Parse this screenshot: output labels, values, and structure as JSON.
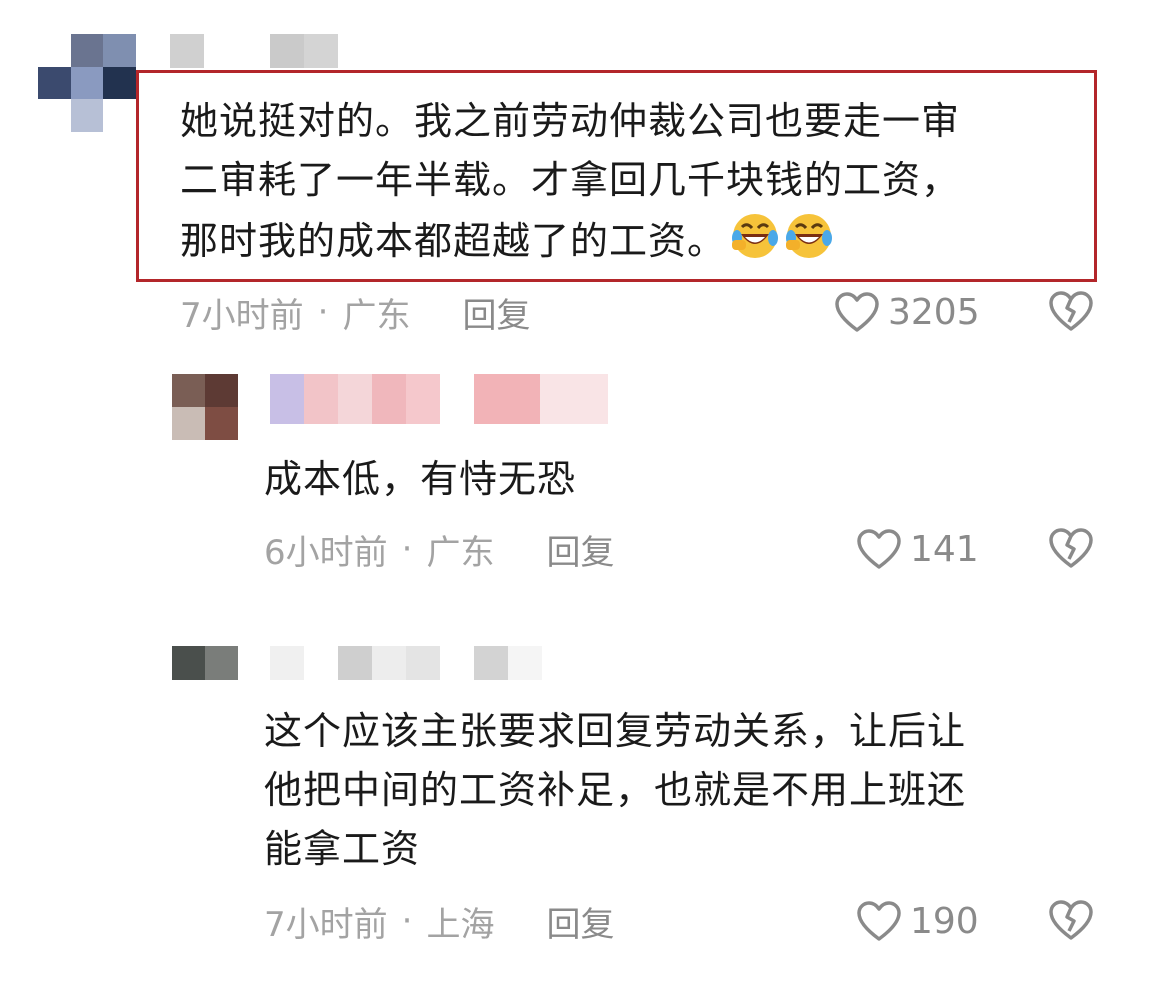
{
  "comments": [
    {
      "text": "她说挺对的。我之前劳动仲裁公司也要走一审\n二审耗了一年半载。才拿回几千块钱的工资，\n那时我的成本都超越了的工资。",
      "emoji": [
        "rofl-emoji",
        "rofl-emoji"
      ],
      "time": "7小时前",
      "dot": "·",
      "location": "广东",
      "reply_label": "回复",
      "likes": "3205",
      "highlighted": true
    },
    {
      "text": "成本低，有恃无恐",
      "time": "6小时前",
      "dot": "·",
      "location": "广东",
      "reply_label": "回复",
      "likes": "141"
    },
    {
      "text": "这个应该主张要求回复劳动关系，让后让\n他把中间的工资补足，也就是不用上班还\n能拿工资",
      "time": "7小时前",
      "dot": "·",
      "location": "上海",
      "reply_label": "回复",
      "likes": "190"
    }
  ],
  "colors": {
    "highlight_border": "#b3262a",
    "meta_text": "#a3a3a3",
    "action_text": "#8a8a8a",
    "body_text": "#1a1a1a",
    "emoji_face": "#f6c33a",
    "emoji_tear": "#4aa8e8"
  },
  "icons": {
    "like": "heart-outline-icon",
    "dislike": "broken-heart-outline-icon",
    "emoji": "rofl-emoji"
  }
}
